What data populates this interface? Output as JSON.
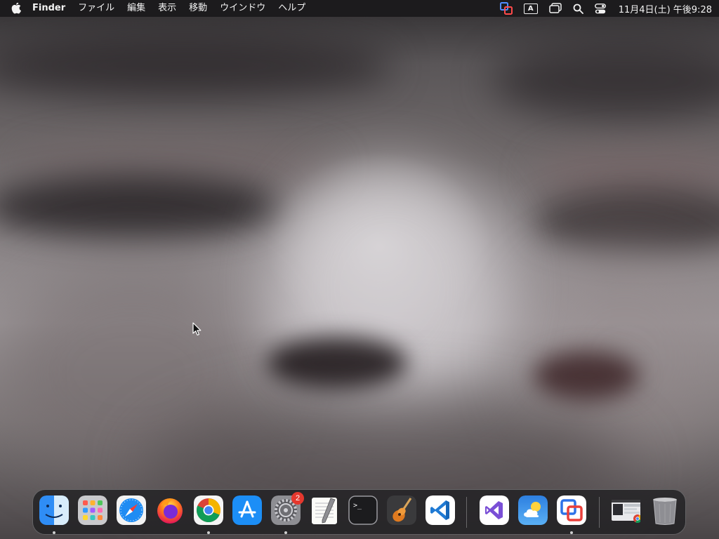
{
  "menubar": {
    "app_name": "Finder",
    "menus": [
      "ファイル",
      "編集",
      "表示",
      "移動",
      "ウインドウ",
      "ヘルプ"
    ],
    "ime_label": "A",
    "clock": "11月4日(土) 午後9:28"
  },
  "dock": {
    "apps": [
      {
        "name": "finder",
        "running": true
      },
      {
        "name": "launchpad",
        "running": false
      },
      {
        "name": "safari",
        "running": false
      },
      {
        "name": "firefox",
        "running": false
      },
      {
        "name": "chrome",
        "running": true
      },
      {
        "name": "app-store",
        "running": false
      },
      {
        "name": "system-preferences",
        "running": true,
        "badge": "2"
      },
      {
        "name": "textedit",
        "running": false
      },
      {
        "name": "terminal",
        "running": false
      },
      {
        "name": "garageband",
        "running": false
      },
      {
        "name": "vscode",
        "running": false
      },
      {
        "name": "visual-studio",
        "running": false
      },
      {
        "name": "weather",
        "running": false
      },
      {
        "name": "screen-sharing",
        "running": true
      },
      {
        "name": "recent-window-preview",
        "running": false
      },
      {
        "name": "trash",
        "running": false
      }
    ],
    "terminal_glyph": ">_"
  },
  "colors": {
    "menubar_bg": "#1c1b1d",
    "badge_red": "#e5382e",
    "vscode_blue": "#1f7ad4",
    "vs_purple": "#7a4fd6"
  }
}
